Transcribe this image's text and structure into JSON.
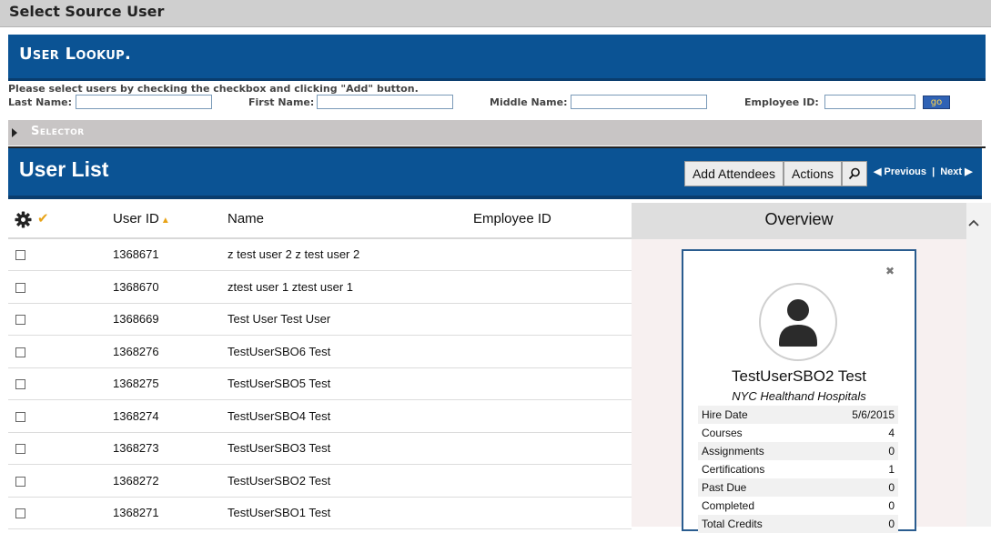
{
  "window": {
    "title": "Select Source User"
  },
  "lookup": {
    "title": "User Lookup.",
    "instructions": "Please select users by checking the checkbox and clicking \"Add\" button.",
    "last_name_label": "Last Name:",
    "first_name_label": "First Name:",
    "middle_name_label": "Middle Name:",
    "employee_id_label": "Employee ID:",
    "go_label": "go"
  },
  "selector": {
    "title": "Selector"
  },
  "user_list": {
    "title": "User List",
    "add_attendees": "Add Attendees",
    "actions": "Actions",
    "previous": "Previous",
    "separator": "|",
    "next": "Next"
  },
  "table": {
    "headers": {
      "user_id": "User ID",
      "name": "Name",
      "employee_id": "Employee ID"
    },
    "sort_indicator": "▲",
    "check_glyph": "✔",
    "rows": [
      {
        "id": "1368671",
        "name": "z test user 2 z test user 2"
      },
      {
        "id": "1368670",
        "name": "ztest user 1 ztest user 1"
      },
      {
        "id": "1368669",
        "name": "Test User Test User"
      },
      {
        "id": "1368276",
        "name": "TestUserSBO6 Test"
      },
      {
        "id": "1368275",
        "name": "TestUserSBO5 Test"
      },
      {
        "id": "1368274",
        "name": "TestUserSBO4 Test"
      },
      {
        "id": "1368273",
        "name": "TestUserSBO3 Test"
      },
      {
        "id": "1368272",
        "name": "TestUserSBO2 Test"
      },
      {
        "id": "1368271",
        "name": "TestUserSBO1 Test"
      }
    ]
  },
  "overview": {
    "title": "Overview",
    "close_glyph": "✖",
    "name": "TestUserSBO2 Test",
    "org": "NYC Healthand Hospitals",
    "stats": [
      {
        "k": "Hire Date",
        "v": "5/6/2015"
      },
      {
        "k": "Courses",
        "v": "4"
      },
      {
        "k": "Assignments",
        "v": "0"
      },
      {
        "k": "Certifications",
        "v": "1"
      },
      {
        "k": "Past Due",
        "v": "0"
      },
      {
        "k": "Completed",
        "v": "0"
      },
      {
        "k": "Total Credits",
        "v": "0"
      }
    ]
  },
  "icons": {
    "settings": "gear-icon",
    "check": "checkmark-icon",
    "search": "magnifier-icon",
    "close": "close-icon",
    "avatar": "user-silhouette-icon",
    "expand": "triangle-right-icon",
    "scroll_up": "chevron-up-icon"
  },
  "colors": {
    "banner": "#0b5394",
    "banner_border": "#0a3d6e",
    "accent_check": "#e8a317",
    "go_text": "#ffd54a"
  }
}
